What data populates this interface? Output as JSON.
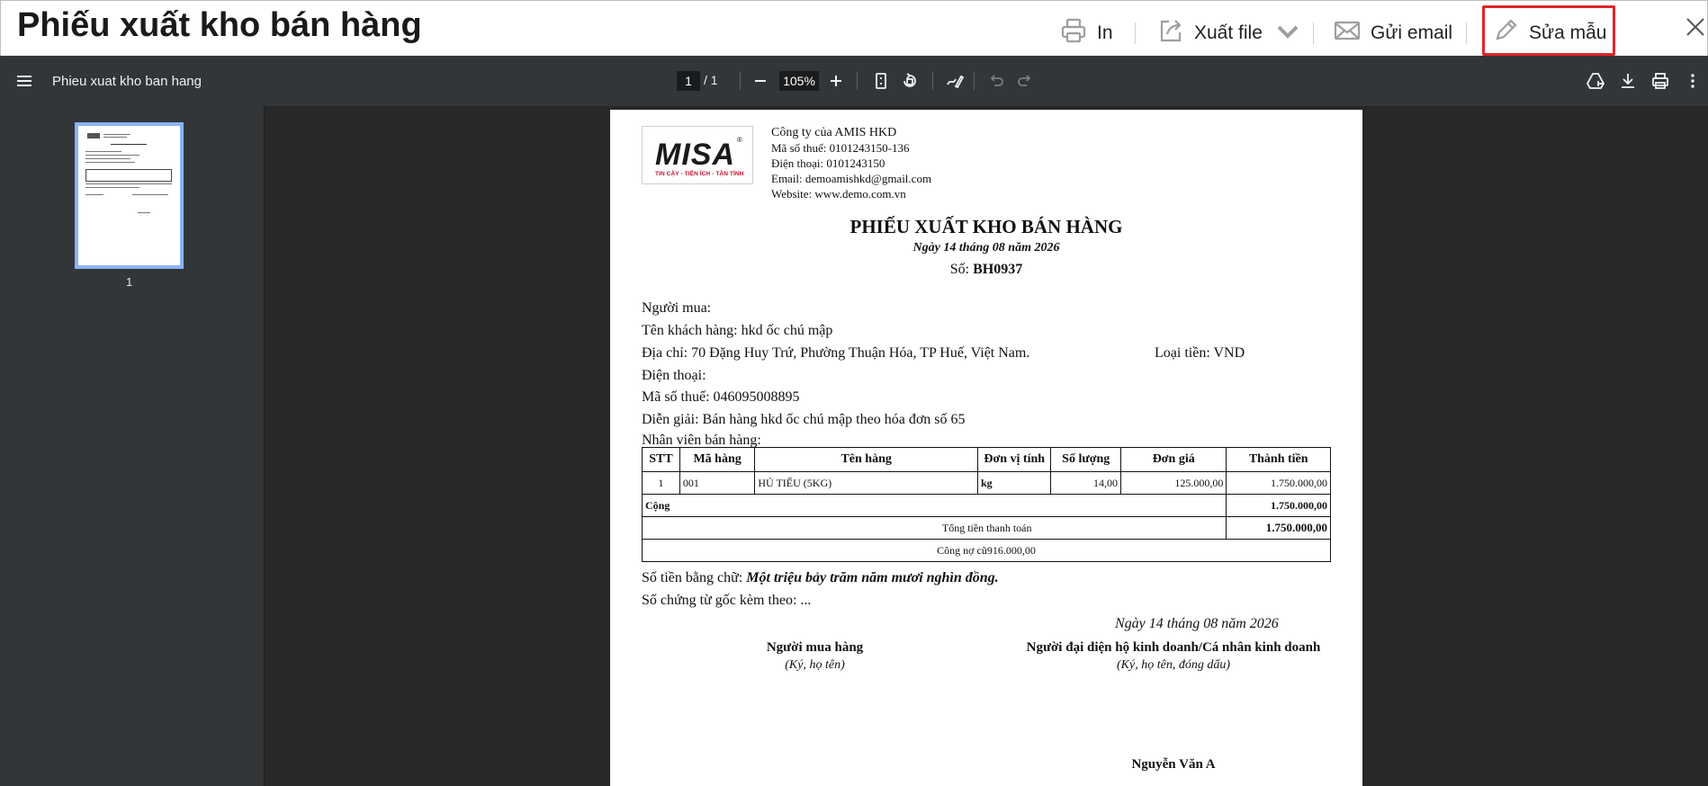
{
  "header": {
    "title": "Phiếu xuất kho bán hàng",
    "print_label": "In",
    "export_label": "Xuất file",
    "email_label": "Gửi email",
    "edit_template_label": "Sửa mẫu"
  },
  "viewer": {
    "doc_name": "Phieu xuat kho ban hang",
    "current_page": "1",
    "page_total": "/  1",
    "zoom": "105%",
    "thumb_page_label": "1"
  },
  "document": {
    "company": {
      "name": "Công ty của AMIS HKD",
      "tax_code": "Mã số thuế: 0101243150-136",
      "phone": "Điện thoại: 0101243150",
      "email": "Email: demoamishkd@gmail.com",
      "website": "Website: www.demo.com.vn",
      "logo_text": "MISA",
      "logo_reg": "®",
      "logo_tagline": "TIN CẬY - TIỆN ÍCH - TẬN TÌNH"
    },
    "title": "PHIẾU XUẤT KHO BÁN HÀNG",
    "date_line": "Ngày 14 tháng 08 năm 2026",
    "number_label": "Số: ",
    "number_value": "BH0937",
    "buyer_label": "Người mua:",
    "customer_name": "Tên khách hàng: hkd ốc chú mập",
    "address": "Địa chỉ: 70 Đặng Huy Trứ, Phường Thuận Hóa, TP Huế, Việt Nam.",
    "currency": "Loại tiền: VND",
    "phone": "Điện thoại:",
    "tax_code": "Mã số thuế: 046095008895",
    "description": "Diễn giải: Bán hàng hkd ốc chú mập theo hóa đơn số 65",
    "salesperson": "Nhân viên bán hàng:",
    "table": {
      "headers": [
        "STT",
        "Mã hàng",
        "Tên hàng",
        "Đơn vị tính",
        "Số lượng",
        "Đơn giá",
        "Thành tiền"
      ],
      "rows": [
        {
          "stt": "1",
          "code": "001",
          "name": "HỦ TIẾU (5KG)",
          "unit": "kg",
          "qty": "14,00",
          "price": "125.000,00",
          "amount": "1.750.000,00"
        }
      ],
      "total_label": "Cộng",
      "total_value": "1.750.000,00",
      "grand_total_label": "Tổng tiền thanh toán",
      "grand_total_value": "1.750.000,00",
      "old_debt": "Công nợ cũ916.000,00"
    },
    "amount_in_words_label": "Số tiền bằng chữ: ",
    "amount_in_words": "Một triệu bảy trăm năm mươi nghìn đồng.",
    "attached_docs": "Số chứng từ gốc kèm theo: ...",
    "sign_date": "Ngày 14 tháng 08 năm 2026",
    "buyer_sign_title": "Người mua hàng",
    "buyer_sign_hint": "(Ký, họ tên)",
    "rep_sign_title": "Người đại diện hộ kinh doanh/Cá nhân kinh doanh",
    "rep_sign_hint": "(Ký, họ tên, đóng dấu)",
    "rep_name": "Nguyễn Văn A"
  },
  "colors": {
    "highlight": "#e0242b",
    "toolbar": "#333639",
    "viewer_bg": "#282828",
    "thumb_border": "#8ab4f8"
  },
  "icons": {
    "print": "printer-icon",
    "export": "export-icon",
    "email": "mail-icon",
    "edit": "pencil-icon",
    "close": "close-icon"
  }
}
